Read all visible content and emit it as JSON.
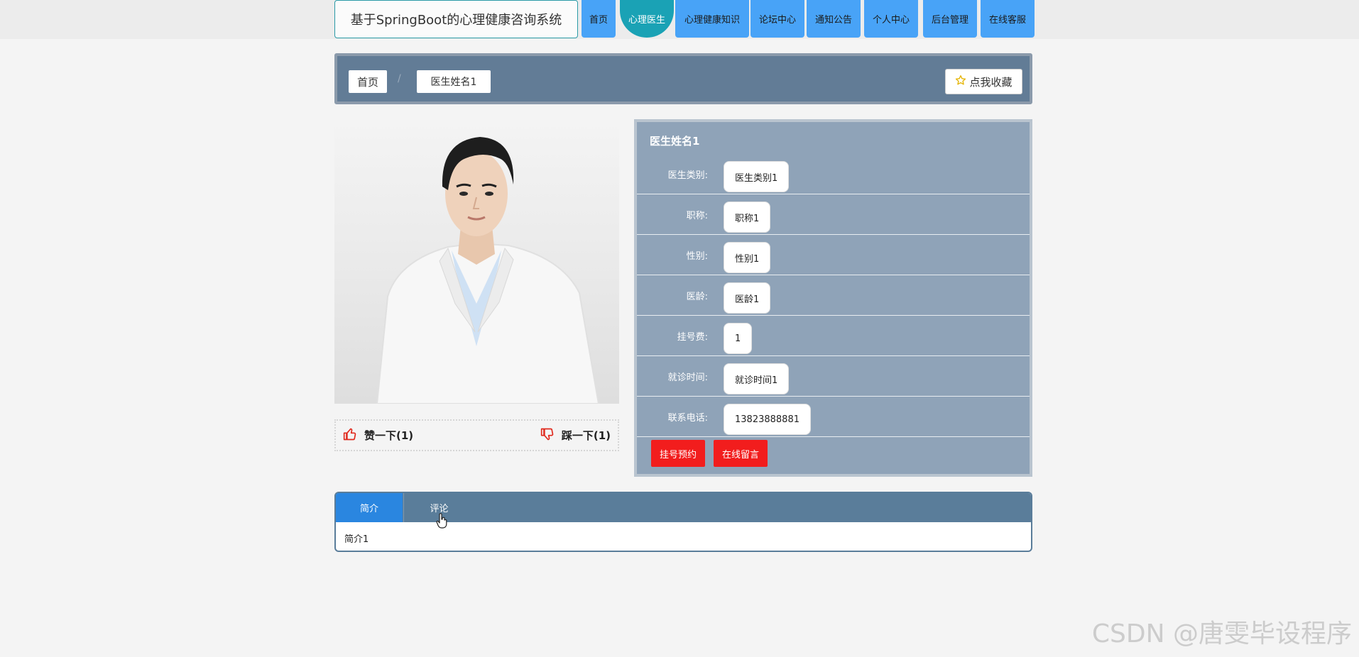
{
  "header": {
    "site_title": "基于SpringBoot的心理健康咨询系统",
    "nav": [
      {
        "label": "首页"
      },
      {
        "label": "心理医生",
        "active": true
      },
      {
        "label": "心理健康知识"
      },
      {
        "label": "论坛中心"
      },
      {
        "label": "通知公告"
      },
      {
        "label": "个人中心"
      },
      {
        "label": "后台管理"
      },
      {
        "label": "在线客服"
      }
    ]
  },
  "breadcrumb": {
    "home": "首页",
    "separator": "/",
    "current": "医生姓名1",
    "favorite_label": "点我收藏"
  },
  "votes": {
    "like_label": "赞一下(1)",
    "dislike_label": "踩一下(1)"
  },
  "doctor": {
    "name": "医生姓名1",
    "fields": [
      {
        "label": "医生类别:",
        "value": "医生类别1"
      },
      {
        "label": "职称:",
        "value": "职称1"
      },
      {
        "label": "性别:",
        "value": "性别1"
      },
      {
        "label": "医龄:",
        "value": "医龄1"
      },
      {
        "label": "挂号费:",
        "value": "1"
      },
      {
        "label": "就诊时间:",
        "value": "就诊时间1"
      },
      {
        "label": "联系电话:",
        "value": "13823888881"
      }
    ],
    "actions": {
      "register": "挂号预约",
      "message": "在线留言"
    }
  },
  "tabs": {
    "items": [
      {
        "label": "简介",
        "active": true
      },
      {
        "label": "评论"
      }
    ],
    "content": "简介1"
  },
  "watermark": "CSDN @唐雯毕设程序",
  "colors": {
    "nav_blue": "#48a3f7",
    "nav_active": "#1aa2b5",
    "panel": "#8fa3b8",
    "crumb_bar": "#627c96",
    "action_red": "#f21d1d",
    "tab_active": "#2a86e0"
  }
}
